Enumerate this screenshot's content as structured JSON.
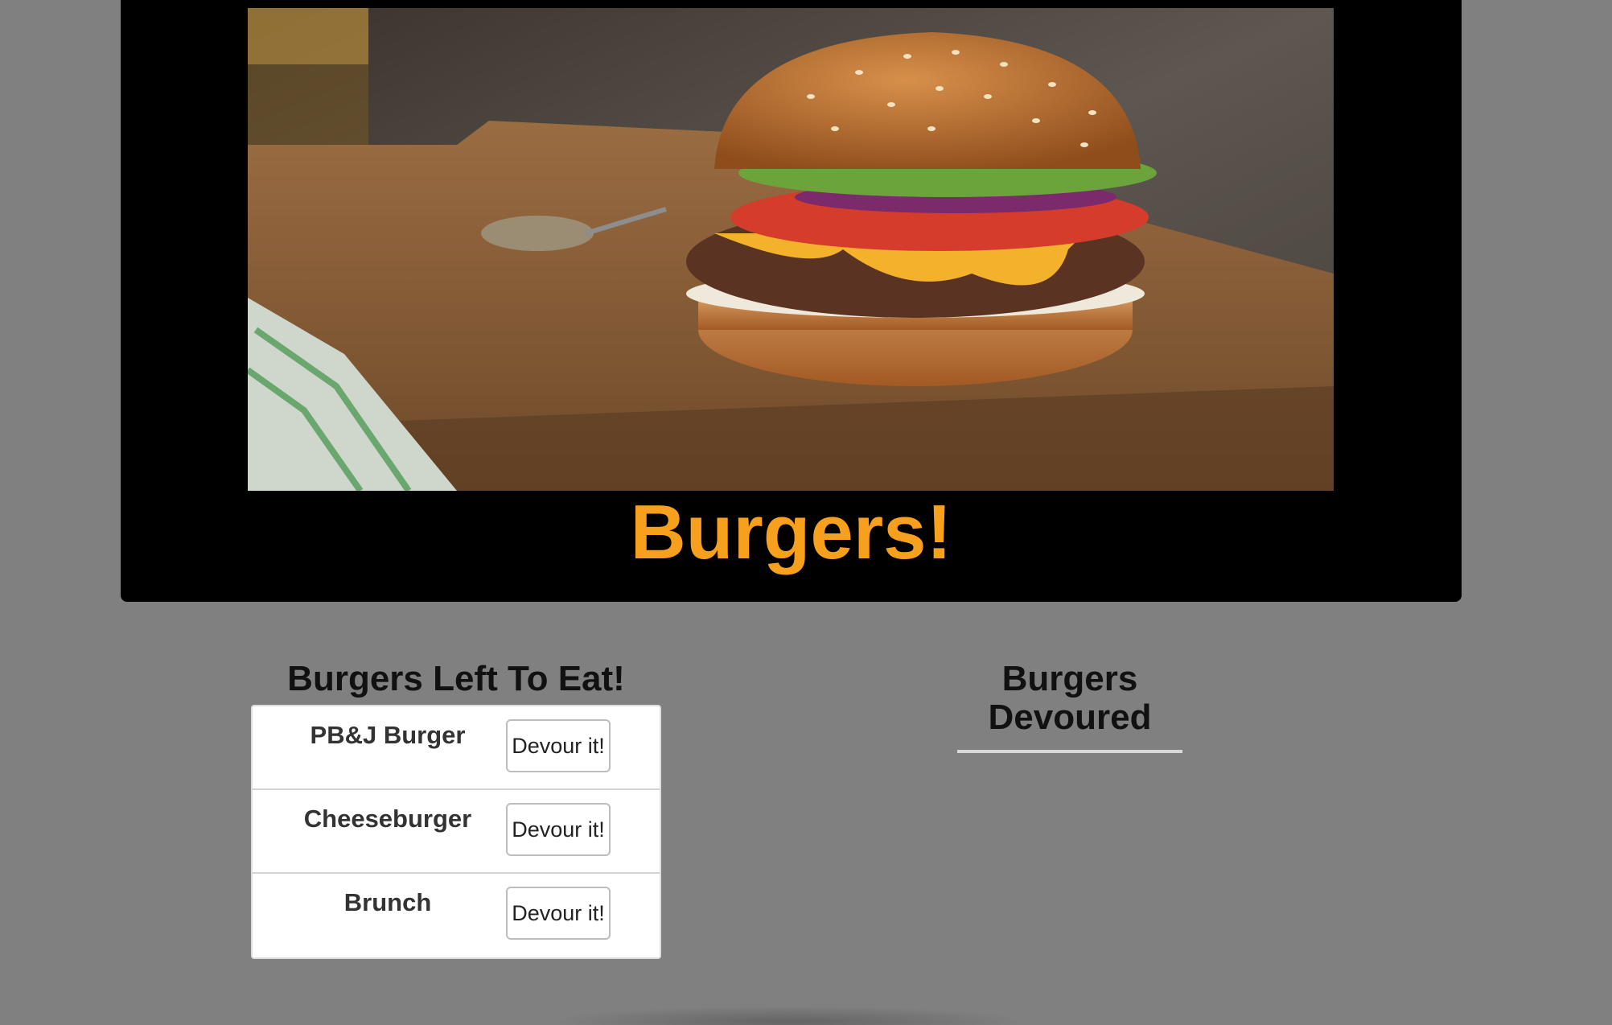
{
  "header": {
    "title": "Burgers!",
    "title_color": "#f7a01e"
  },
  "hero_image": {
    "alt": "burger-photo"
  },
  "left_column": {
    "heading": "Burgers Left To Eat!",
    "burgers": [
      {
        "name": "PB&J Burger",
        "button_label": "Devour it!"
      },
      {
        "name": "Cheeseburger",
        "button_label": "Devour it!"
      },
      {
        "name": "Brunch",
        "button_label": "Devour it!"
      }
    ]
  },
  "right_column": {
    "heading_line1": "Burgers",
    "heading_line2": "Devoured",
    "burgers": []
  }
}
